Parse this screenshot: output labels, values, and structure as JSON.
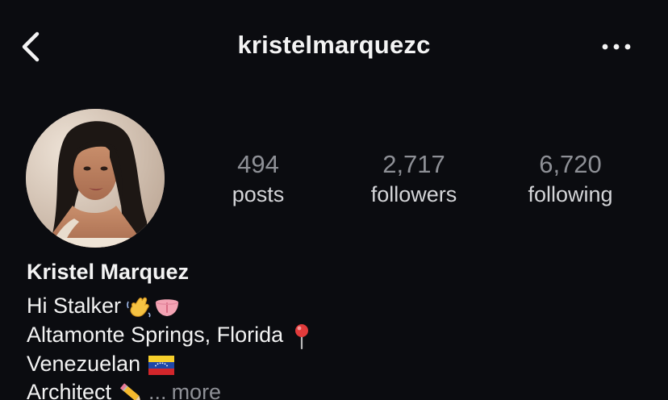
{
  "header": {
    "username": "kristelmarquezc"
  },
  "stats": {
    "posts": {
      "count": "494",
      "label": "posts"
    },
    "followers": {
      "count": "2,717",
      "label": "followers"
    },
    "following": {
      "count": "6,720",
      "label": "following"
    }
  },
  "bio": {
    "name": "Kristel Marquez",
    "line1": "Hi Stalker",
    "line2": "Altamonte Springs, Florida",
    "line3": "Venezuelan",
    "line4": "Architect",
    "ellipsis": "...",
    "more": "more"
  },
  "icons": {
    "back": "chevron-left-icon",
    "menu": "ellipsis-icon",
    "line1_emojis": [
      "waving-hand-icon",
      "tongue-icon"
    ],
    "line2_emoji": "round-pushpin-icon",
    "line3_emoji": "venezuela-flag-icon",
    "line4_emoji": "pencil-icon"
  },
  "colors": {
    "background": "#0b0c10",
    "primary_text": "#f4f4f4",
    "secondary_text": "#8e9096"
  }
}
